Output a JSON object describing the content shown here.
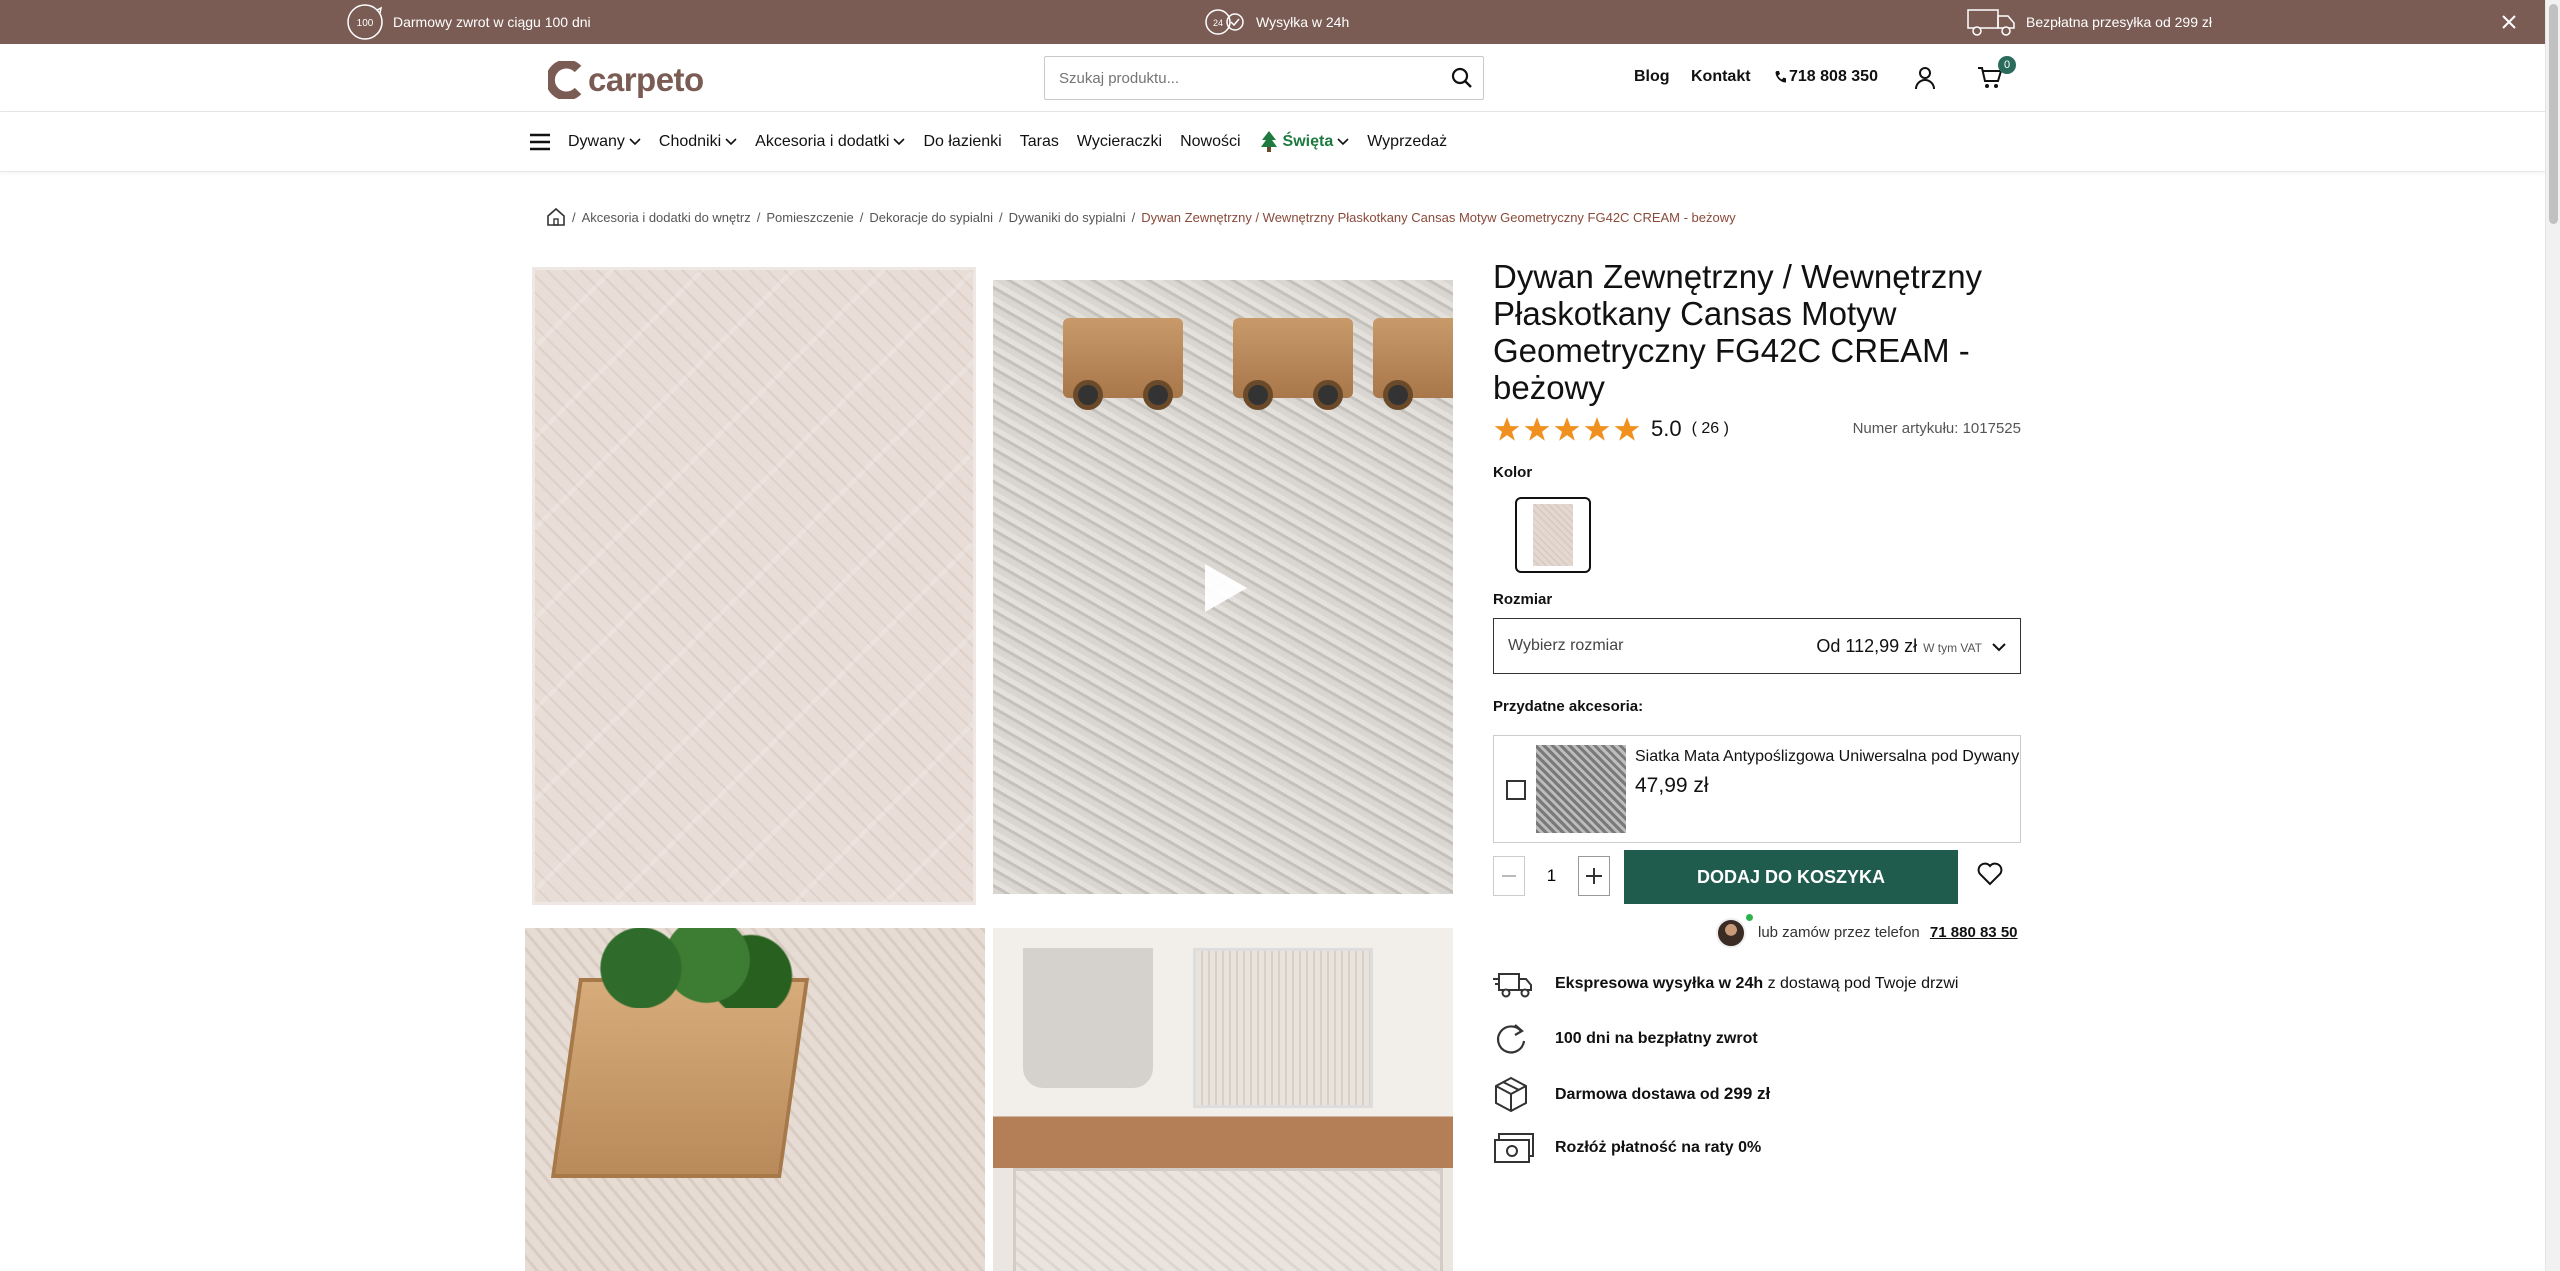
{
  "topbar": {
    "return_text": "Darmowy zwrot w ciągu 100 dni",
    "return_icon_text": "100",
    "shipping_text": "Wysyłka w 24h",
    "shipping_icon_text": "24",
    "free_delivery_text": "Bezpłatna przesyłka od 299 zł"
  },
  "header": {
    "logo_text": "carpeto",
    "search_placeholder": "Szukaj produktu...",
    "blog_label": "Blog",
    "contact_label": "Kontakt",
    "phone_label": "718 808 350",
    "cart_count": "0"
  },
  "nav": {
    "items": [
      {
        "label": "Dywany"
      },
      {
        "label": "Chodniki"
      },
      {
        "label": "Akcesoria i dodatki"
      },
      {
        "label": "Do łazienki"
      },
      {
        "label": "Taras"
      },
      {
        "label": "Wycieraczki"
      },
      {
        "label": "Nowości"
      },
      {
        "label": "Święta"
      },
      {
        "label": "Wyprzedaż"
      }
    ]
  },
  "breadcrumb": {
    "items": [
      "Akcesoria i dodatki do wnętrz",
      "Pomieszczenie",
      "Dekoracje do sypialni",
      "Dywaniki do sypialni"
    ],
    "current": "Dywan Zewnętrzny / Wewnętrzny Płaskotkany Cansas Motyw Geometryczny FG42C CREAM - beżowy"
  },
  "product": {
    "title": "Dywan Zewnętrzny / Wewnętrzny Płaskotkany Cansas Motyw Geometryczny FG42C CREAM - beżowy",
    "rating": "5.0",
    "rating_count": "( 26 )",
    "stars": 5,
    "article_label": "Numer artykułu: 1017525",
    "color_label": "Kolor",
    "size_label": "Rozmiar",
    "size_placeholder": "Wybierz rozmiar",
    "size_price": "Od 112,99 zł",
    "size_vat": "W tym VAT",
    "accessories_label": "Przydatne akcesoria:",
    "accessory_name": "Siatka Mata Antypoślizgowa Uniwersalna pod Dywany",
    "accessory_price": "47,99 zł",
    "quantity": "1",
    "add_to_cart": "DODAJ DO KOSZYKA",
    "phone_order_text": "lub zamów przez telefon",
    "phone_order_number": "71 880 83 50"
  },
  "benefits": {
    "express_bold": "Ekspresowa wysyłka w 24h",
    "express_rest": " z dostawą pod Twoje drzwi",
    "return_bold": "100 dni na bezpłatny zwrot",
    "delivery_text": "Darmowa dostawa od ",
    "delivery_amount": "299 zł",
    "installments_bold": "Rozłóż płatność na raty 0%"
  },
  "colors": {
    "topbar": "#7a5c55",
    "accent": "#1f5c4e",
    "star": "#f0901e",
    "holiday": "#1f7a40"
  }
}
